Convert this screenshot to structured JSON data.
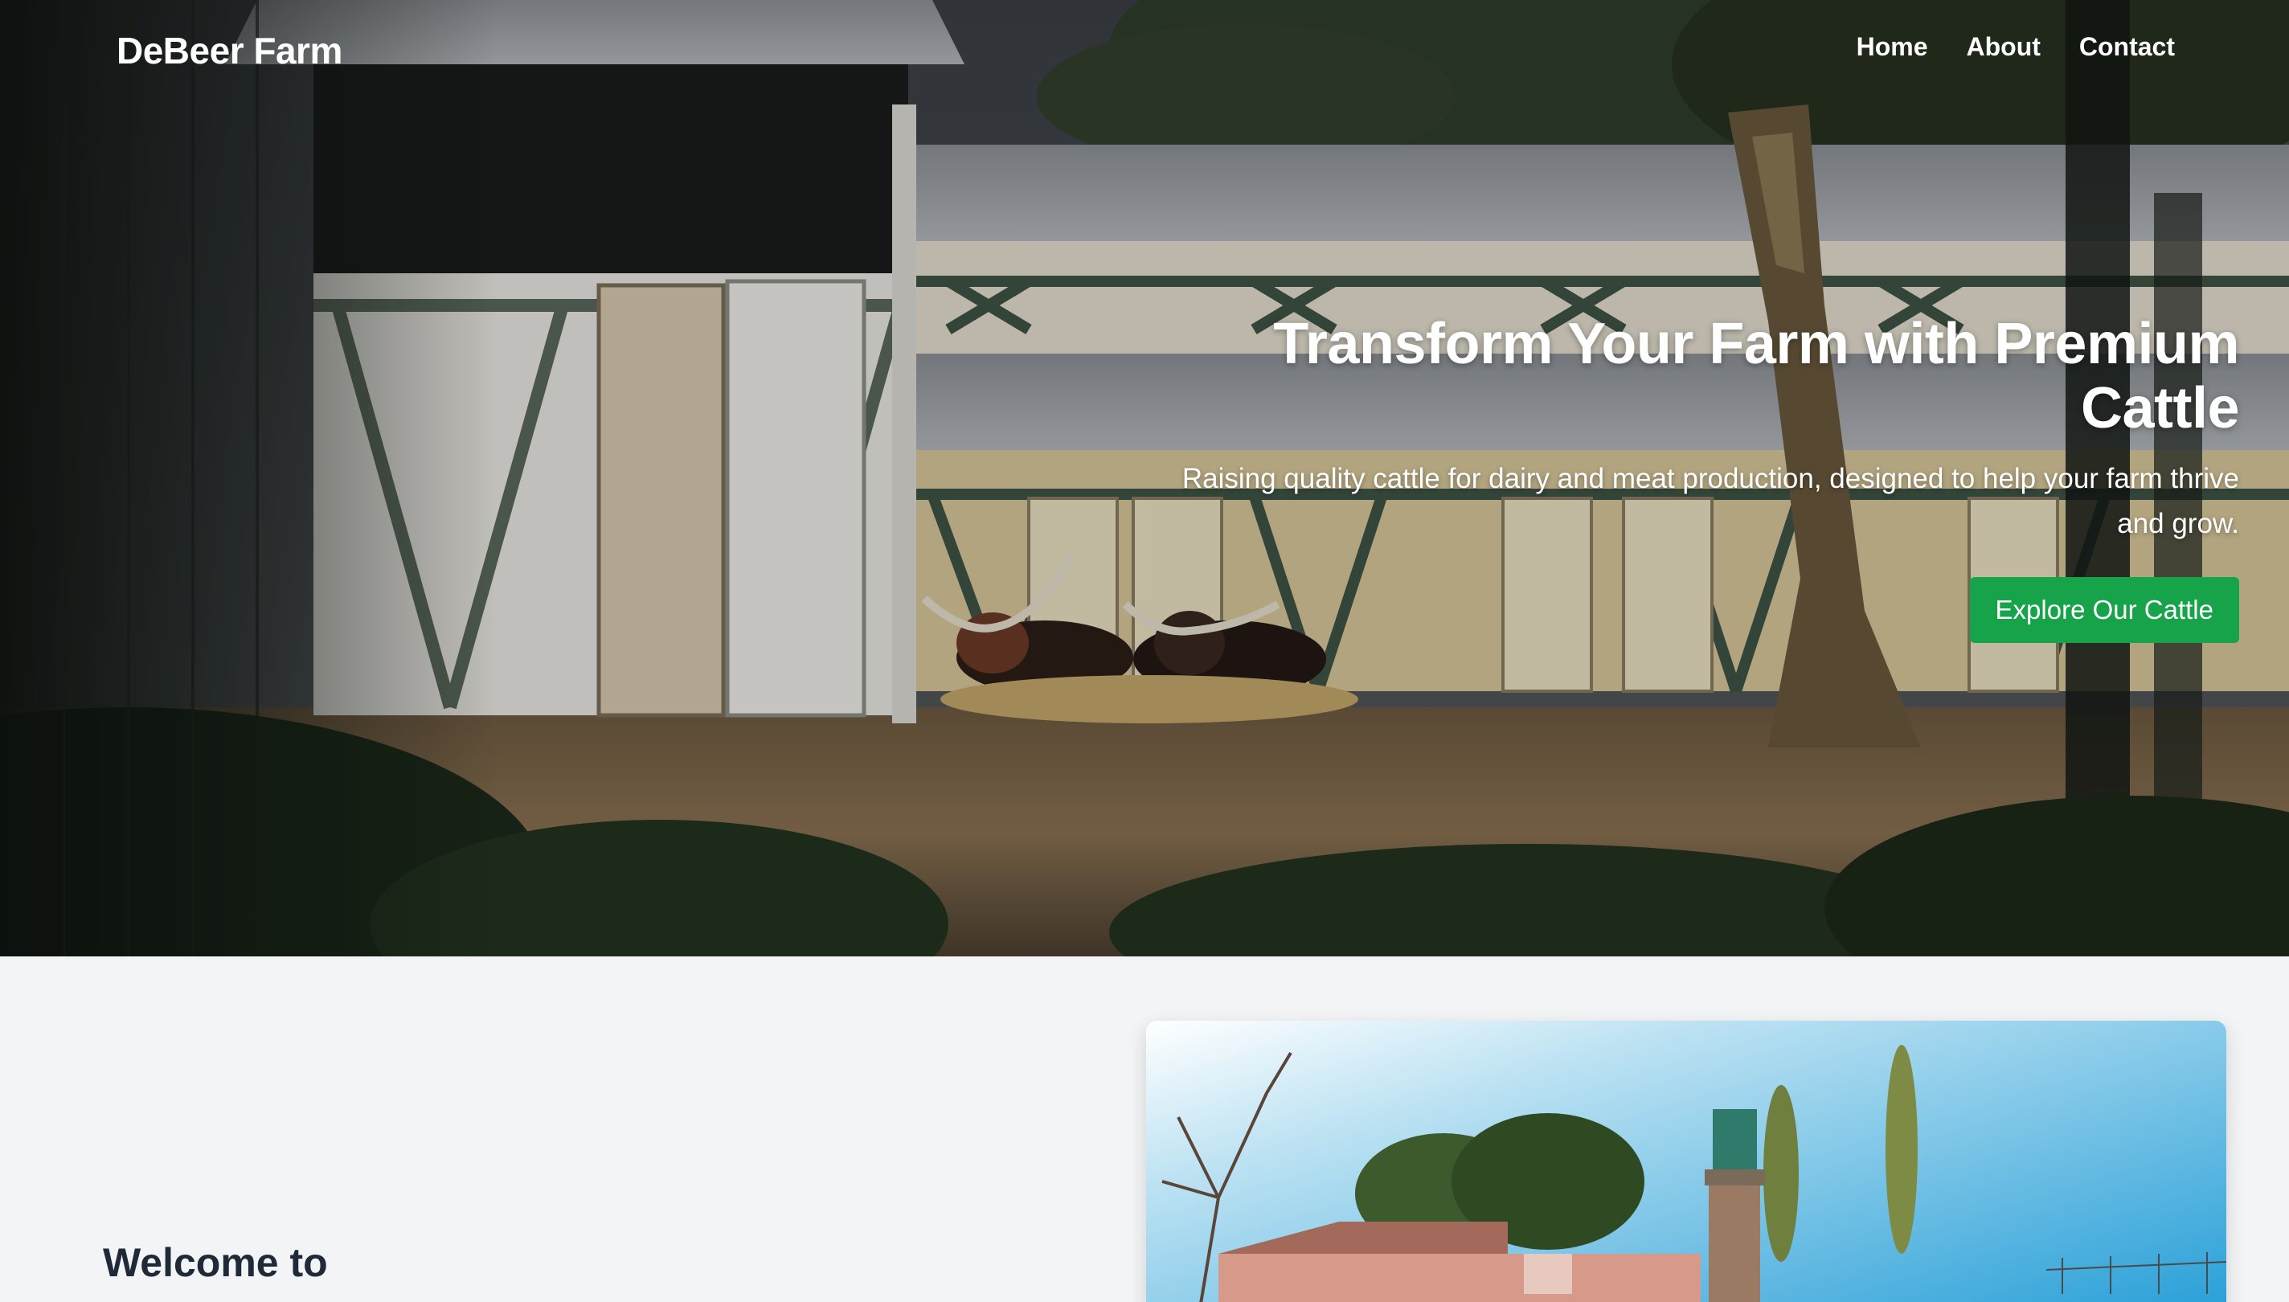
{
  "brand": "DeBeer Farm",
  "nav": {
    "items": [
      {
        "label": "Home"
      },
      {
        "label": "About"
      },
      {
        "label": "Contact"
      }
    ]
  },
  "hero": {
    "title": "Transform Your Farm with Premium Cattle",
    "subtitle": "Raising quality cattle for dairy and meat production, designed to help your farm thrive and grow.",
    "cta_label": "Explore Our Cattle"
  },
  "about": {
    "heading": "Welcome to"
  },
  "colors": {
    "accent": "#16a34a",
    "section_bg": "#f3f4f6",
    "heading_text": "#1f2937"
  },
  "icons": {
    "hero_image": "farm-barn-cattle-photo",
    "about_image": "farm-landscape-photo"
  }
}
